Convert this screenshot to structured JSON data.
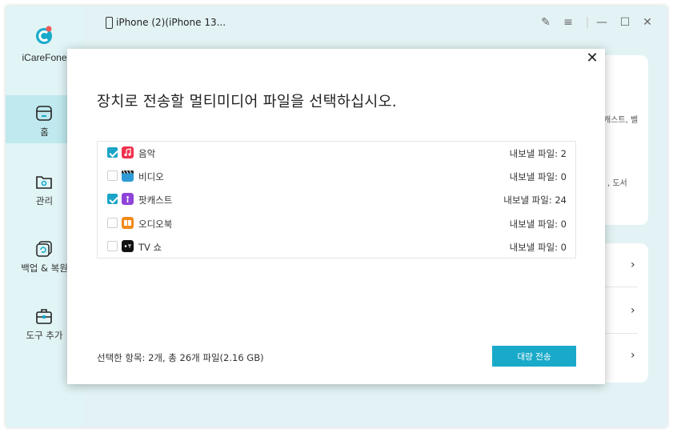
{
  "app": {
    "name": "iCareFone"
  },
  "device": {
    "name": "iPhone (2)(iPhone 13..."
  },
  "colors": {
    "accent": "#19aac9",
    "checkbox": "#1aa4c6",
    "sidebar_active": "#bfe9ee"
  },
  "sidebar": {
    "items": [
      {
        "label": "홈",
        "icon": "home-icon"
      },
      {
        "label": "관리",
        "icon": "folder-icon"
      },
      {
        "label": "백업 & 복원",
        "icon": "backup-restore-icon"
      },
      {
        "label": "도구 추가",
        "icon": "toolbox-icon"
      }
    ]
  },
  "background": {
    "snippet1": "캐스트, 벨",
    "snippet2": ", 도서"
  },
  "modal": {
    "title": "장치로 전송할 멀티미디어 파일을 선택하십시오.",
    "rows": [
      {
        "label": "음악",
        "count": "내보낼 파일: 2",
        "checked": true,
        "icon": "music-icon"
      },
      {
        "label": "비디오",
        "count": "내보낼 파일: 0",
        "checked": false,
        "icon": "video-icon"
      },
      {
        "label": "팟캐스트",
        "count": "내보낼 파일: 24",
        "checked": true,
        "icon": "podcast-icon"
      },
      {
        "label": "오디오북",
        "count": "내보낼 파일: 0",
        "checked": false,
        "icon": "audiobook-icon"
      },
      {
        "label": "TV 쇼",
        "count": "내보낼 파일: 0",
        "checked": false,
        "icon": "tv-icon"
      }
    ],
    "summary": "선택한 항목: 2개, 총 26개 파일(2.16 GB)",
    "export_button": "대량 전송"
  }
}
